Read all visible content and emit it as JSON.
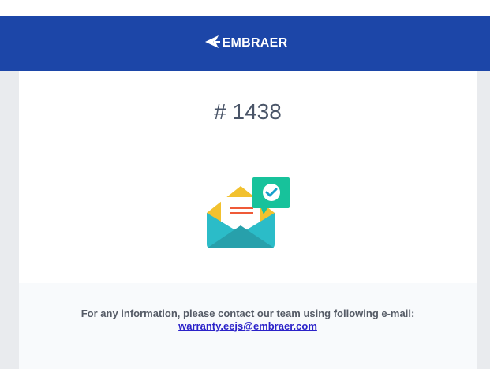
{
  "header": {
    "brand_name": "EMBRAER",
    "background_color": "#1c46a8",
    "logo_icon": "embraer-logo-icon"
  },
  "main": {
    "ticket_label": "# 1438",
    "illustration_icon": "envelope-check-icon"
  },
  "footer": {
    "message": "For any information, please contact our team using following e-mail:",
    "email": "warranty.eejs@embraer.com",
    "link_color": "#2b22c9"
  }
}
